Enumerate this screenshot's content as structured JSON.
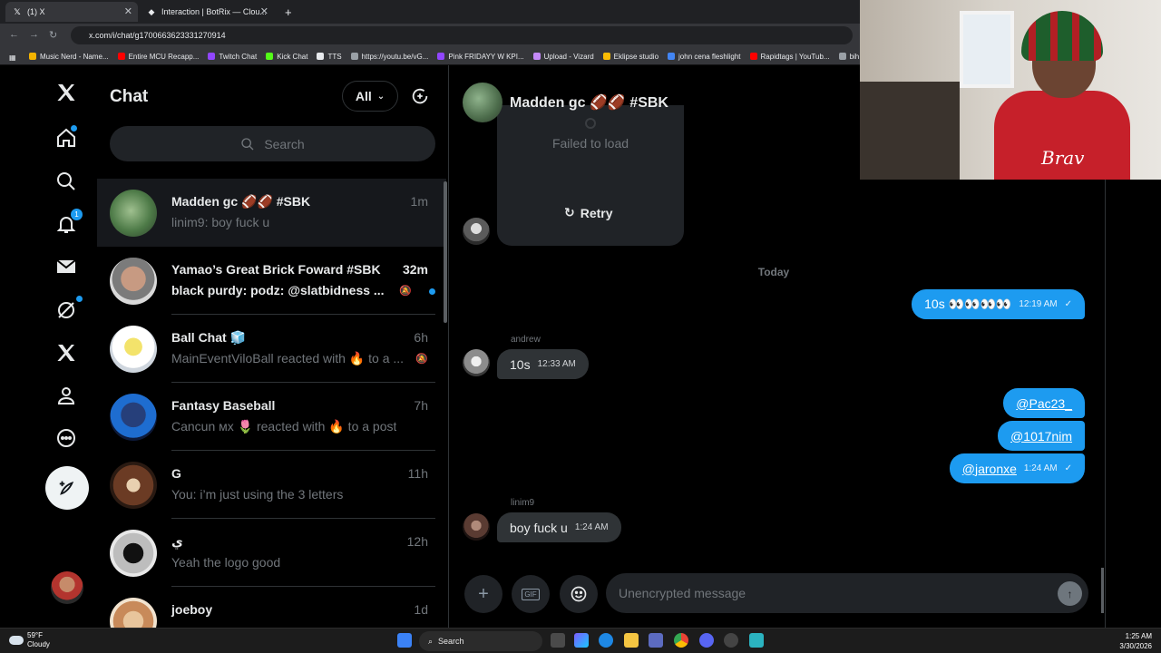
{
  "browser": {
    "tabs": [
      {
        "title": "(1) X",
        "active": true
      },
      {
        "title": "Interaction | BotRix — Clou...",
        "active": false
      }
    ],
    "url": "x.com/i/chat/g1700663623331270914",
    "bookmarks": [
      {
        "label": "Music Nerd - Name...",
        "color": "#f4b400"
      },
      {
        "label": "Entire MCU Recapp...",
        "color": "#ff0000"
      },
      {
        "label": "Twitch Chat",
        "color": "#9146ff"
      },
      {
        "label": "Kick Chat",
        "color": "#53fc18"
      },
      {
        "label": "TTS",
        "color": "#e8eaed"
      },
      {
        "label": "https://youtu.be/vG...",
        "color": "#9aa0a6"
      },
      {
        "label": "Pink FRIDAYY W KPI...",
        "color": "#9146ff"
      },
      {
        "label": "Upload - Vizard",
        "color": "#c58af9"
      },
      {
        "label": "Eklipse studio",
        "color": "#fbbc04"
      },
      {
        "label": "john cena fleshlight",
        "color": "#4285f4"
      },
      {
        "label": "Rapidtags | YouTub...",
        "color": "#ff0000"
      },
      {
        "label": "bih links",
        "color": "#9aa0a6"
      }
    ]
  },
  "webcam": {
    "shirt_text": "Brav"
  },
  "nav": {
    "notifications_badge": "1",
    "items": [
      "x-logo",
      "home",
      "explore",
      "notifications",
      "messages",
      "grok",
      "premium",
      "profile",
      "more"
    ]
  },
  "chatlist": {
    "title": "Chat",
    "filter_label": "All",
    "search_placeholder": "Search",
    "conversations": [
      {
        "name": "Madden gc 🏈🏈 #SBK",
        "time": "1m",
        "preview": "linim9: boy fuck u",
        "selected": true,
        "unread": false,
        "muted": false
      },
      {
        "name": "Yamao’s Great Brick Foward #SBK",
        "time": "32m",
        "preview": "black purdy: podz: @slatbidness ...",
        "selected": false,
        "unread": true,
        "muted": true
      },
      {
        "name": "Ball Chat 🧊",
        "time": "6h",
        "preview": "MainEventViloBall reacted with 🔥 to a ...",
        "selected": false,
        "unread": false,
        "muted": true
      },
      {
        "name": "Fantasy Baseball",
        "time": "7h",
        "preview": "Cancun ᴍx 🌷 reacted with 🔥 to a post",
        "selected": false,
        "unread": false,
        "muted": false
      },
      {
        "name": "G",
        "time": "11h",
        "preview": "You: i’m just using the 3 letters",
        "selected": false,
        "unread": false,
        "muted": false
      },
      {
        "name": "ي",
        "time": "12h",
        "preview": "Yeah the logo good",
        "selected": false,
        "unread": false,
        "muted": false
      },
      {
        "name": "joeboy",
        "time": "1d",
        "preview": "",
        "selected": false,
        "unread": false,
        "muted": false
      }
    ]
  },
  "conversation": {
    "title": "Madden gc 🏈🏈 #SBK",
    "failed_text": "Failed to load",
    "retry_label": "Retry",
    "day_separator": "Today",
    "messages": {
      "out1": {
        "text": "10s 👀👀👀👀",
        "time": "12:19 AM"
      },
      "in1": {
        "sender": "andrew",
        "text": "10s",
        "time": "12:33 AM"
      },
      "out2": {
        "text": "@Pac23_"
      },
      "out3": {
        "text": "@1017nim"
      },
      "out4": {
        "text": "@jaronxe",
        "time": "1:24 AM"
      },
      "in2": {
        "sender": "linim9",
        "text": "boy fuck u",
        "time": "1:24 AM"
      }
    },
    "composer_placeholder": "Unencrypted message"
  },
  "taskbar": {
    "weather_temp": "59°F",
    "weather_desc": "Cloudy",
    "search_label": "Search",
    "time": "1:25 AM",
    "date": "3/30/2026"
  },
  "colors": {
    "accent": "#1d9bf0",
    "background": "#000000",
    "bubble_in": "#2f3336"
  }
}
